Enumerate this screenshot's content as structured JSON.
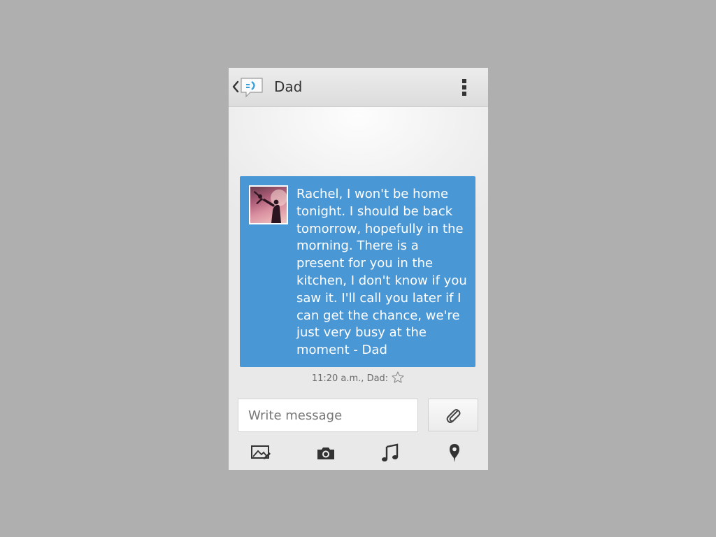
{
  "header": {
    "title": "Dad"
  },
  "message": {
    "text": "Rachel, I won't be home\ntonight. I should be back\ntomorrow, hopefully in the\nmorning. There is a\npresent for you in the\nkitchen, I don't know if you\nsaw it. I'll call you later if I\ncan get the chance, we're\njust very busy at the\nmoment - Dad",
    "meta": "11:20 a.m., Dad:",
    "bubble_color": "#4a97d6"
  },
  "compose": {
    "placeholder": "Write message",
    "value": ""
  },
  "toolbar": {
    "items": [
      "picture-icon",
      "camera-icon",
      "music-note-icon",
      "location-pin-icon"
    ]
  },
  "colors": {
    "background": "#afafaf",
    "accent": "#4a97d6"
  }
}
